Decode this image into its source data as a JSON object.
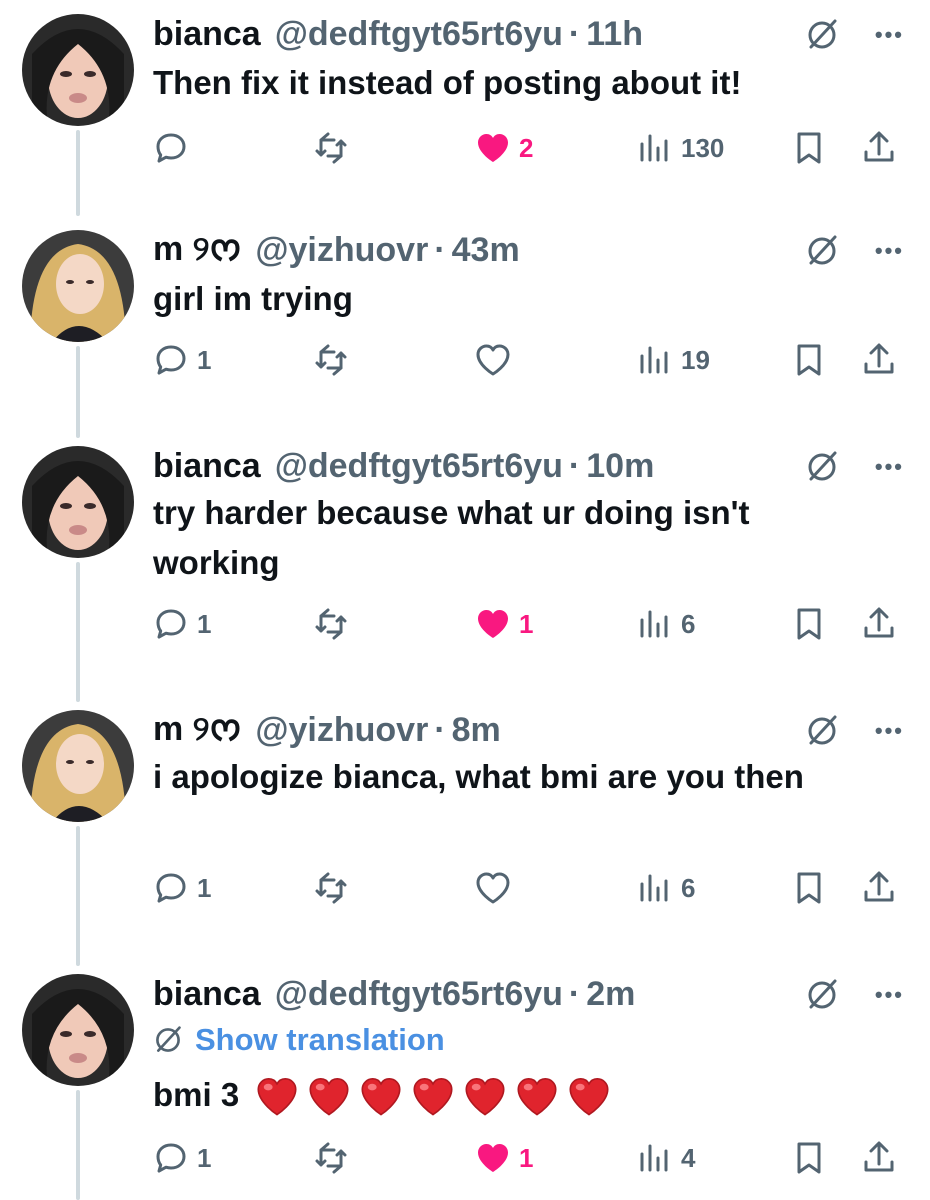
{
  "tweets": [
    {
      "author": "bianca",
      "handle": "@dedftgyt65rt6yu",
      "separator": "·",
      "time": "11h",
      "text": "Then fix it instead of posting about it!",
      "show_translation": "",
      "replies": "",
      "likes": "2",
      "liked": true,
      "views": "130"
    },
    {
      "author": "m ୨ᰔ",
      "handle": "@yizhuovr",
      "separator": "·",
      "time": "43m",
      "text": "girl im trying",
      "show_translation": "",
      "replies": "1",
      "likes": "",
      "liked": false,
      "views": "19"
    },
    {
      "author": "bianca",
      "handle": "@dedftgyt65rt6yu",
      "separator": "·",
      "time": "10m",
      "text": "try harder because what ur doing isn't working",
      "show_translation": "",
      "replies": "1",
      "likes": "1",
      "liked": true,
      "views": "6"
    },
    {
      "author": "m ୨ᰔ",
      "handle": "@yizhuovr",
      "separator": "·",
      "time": "8m",
      "text": "i apologize bianca, what bmi are you then",
      "show_translation": "",
      "replies": "1",
      "likes": "",
      "liked": false,
      "views": "6"
    },
    {
      "author": "bianca",
      "handle": "@dedftgyt65rt6yu",
      "separator": "·",
      "time": "2m",
      "text": "bmi 3",
      "emoji_count": 7,
      "show_translation": "Show translation",
      "replies": "1",
      "likes": "1",
      "liked": true,
      "views": "4"
    }
  ],
  "icons": {
    "reply": "reply-icon",
    "retweet": "retweet-icon",
    "like": "heart-icon",
    "views": "views-icon",
    "bookmark": "bookmark-icon",
    "share": "share-icon",
    "grok": "grok-icon",
    "more": "more-icon"
  },
  "colors": {
    "like_active": "#f91880",
    "muted": "#536471",
    "link": "#4a90e2",
    "text": "#0f1419",
    "thread_line": "#cfd9de"
  }
}
